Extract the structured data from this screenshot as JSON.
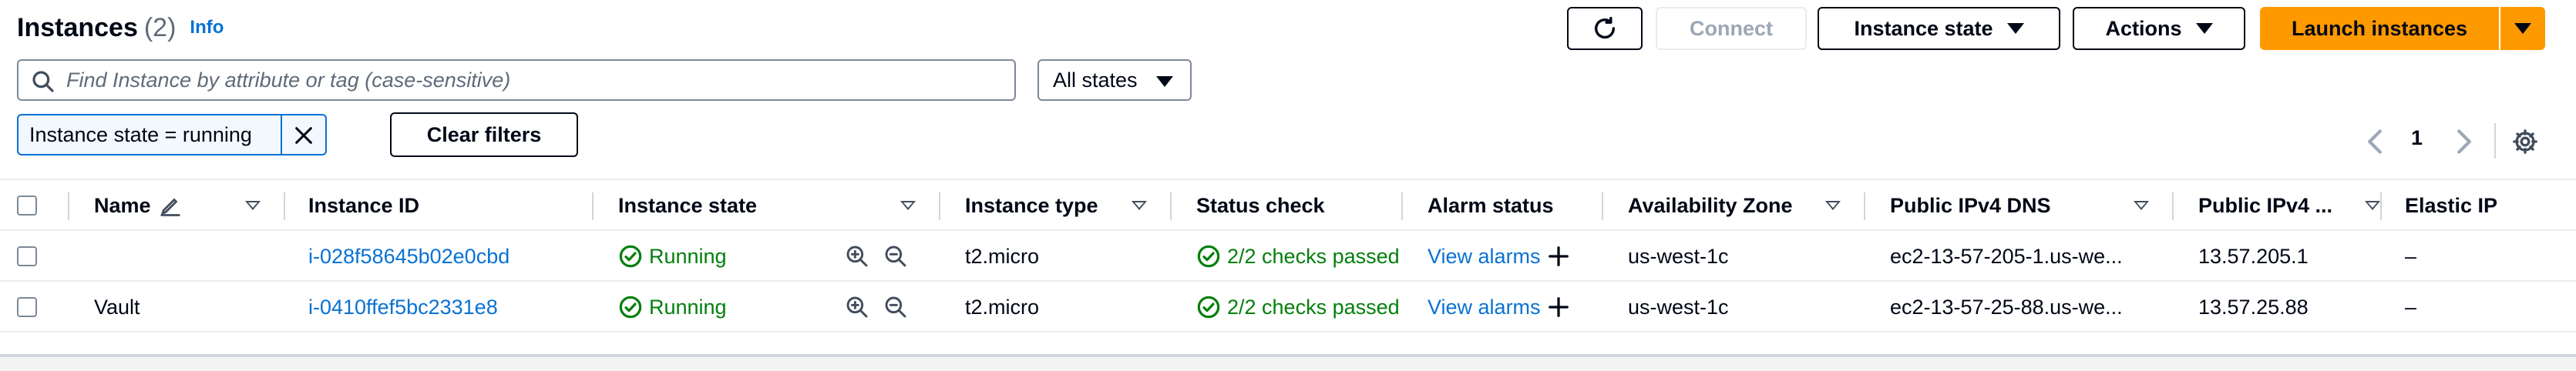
{
  "header": {
    "title": "Instances",
    "count": "(2)",
    "info_label": "Info"
  },
  "toolbar": {
    "connect_label": "Connect",
    "instance_state_label": "Instance state",
    "actions_label": "Actions",
    "launch_label": "Launch instances"
  },
  "search": {
    "placeholder": "Find Instance by attribute or tag (case-sensitive)",
    "value": ""
  },
  "state_filter": {
    "selected": "All states"
  },
  "filter_token": {
    "label": "Instance state = running"
  },
  "clear_filters_label": "Clear filters",
  "pagination": {
    "current_page": "1"
  },
  "table": {
    "columns": [
      "Name",
      "Instance ID",
      "Instance state",
      "Instance type",
      "Status check",
      "Alarm status",
      "Availability Zone",
      "Public IPv4 DNS",
      "Public IPv4 ...",
      "Elastic IP"
    ],
    "rows": [
      {
        "name": "",
        "instance_id": "i-028f58645b02e0cbd",
        "state": "Running",
        "type": "t2.micro",
        "status_check": "2/2 checks passed",
        "alarm": "View alarms",
        "az": "us-west-1c",
        "dns": "ec2-13-57-205-1.us-we...",
        "ipv4": "13.57.205.1",
        "elastic_ip": "–"
      },
      {
        "name": "Vault",
        "instance_id": "i-0410ffef5bc2331e8",
        "state": "Running",
        "type": "t2.micro",
        "status_check": "2/2 checks passed",
        "alarm": "View alarms",
        "az": "us-west-1c",
        "dns": "ec2-13-57-25-88.us-we...",
        "ipv4": "13.57.25.88",
        "elastic_ip": "–"
      }
    ]
  },
  "colors": {
    "primary_button": "#ff9900",
    "link": "#0972d3",
    "success": "#037f0c"
  },
  "icons": [
    "search-icon",
    "refresh-icon",
    "close-icon",
    "chevron-left-icon",
    "chevron-right-icon",
    "gear-icon",
    "edit-icon",
    "zoom-in-icon",
    "zoom-out-icon",
    "check-circle-icon",
    "plus-icon"
  ]
}
